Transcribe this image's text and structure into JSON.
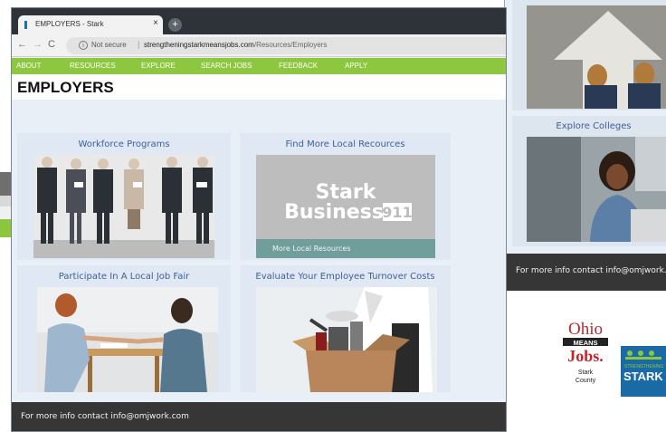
{
  "browser": {
    "tab_title": "EMPLOYERS - Stark",
    "tab_close": "×",
    "new_tab": "+",
    "nav_back": "←",
    "nav_forward": "→",
    "nav_reload": "C",
    "security_label": "Not secure",
    "separator": "|",
    "url_domain": "strengtheningstarkmeansjobs.com",
    "url_path": "/Resources/Employers"
  },
  "nav": {
    "items": [
      "ABOUT",
      "RESOURCES",
      "EXPLORE",
      "SEARCH JOBS",
      "FEEDBACK",
      "APPLY"
    ]
  },
  "page": {
    "title": "EMPLOYERS"
  },
  "cards": [
    {
      "title": "Workforce Programs"
    },
    {
      "title": "Find More Local Recources",
      "image_text_top": "Stark",
      "image_text_bottom": "Business",
      "image_badge": "911",
      "caption": "More Local Resources"
    },
    {
      "title": "Participate In A Local Job Fair"
    },
    {
      "title": "Evaluate Your Employee Turnover Costs"
    }
  ],
  "footer": {
    "contact_label": "For more info contact",
    "contact_email": "info@omjwork.com"
  },
  "back_window": {
    "colleges_title": "Explore Colleges",
    "footer_text": "For more info contact  info@omjwork.com"
  },
  "logos": {
    "ohio_lines": [
      "Ohio",
      "MEANS",
      "Jobs.",
      "Stark",
      "County"
    ],
    "stark_top": "STRENGTHENING",
    "stark_main": "STARK"
  },
  "colors": {
    "nav_green": "#8dc63f",
    "card_title_blue": "#3f5f98",
    "footer_dark": "#363636",
    "page_bg": "#e8eff7",
    "ohio_red": "#c0272d"
  }
}
